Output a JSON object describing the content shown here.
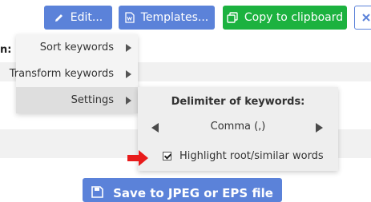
{
  "toolbar": {
    "edit_label": "Edit...",
    "templates_label": "Templates...",
    "copy_label": "Copy to clipboard",
    "cut_off_icon": "x-icon"
  },
  "form": {
    "label_fragment": "n:"
  },
  "menu": {
    "items": [
      {
        "label": "Sort keywords",
        "has_submenu": true
      },
      {
        "label": "Transform keywords",
        "has_submenu": true
      },
      {
        "label": "Settings",
        "has_submenu": true,
        "selected": true
      }
    ]
  },
  "settings_panel": {
    "title": "Delimiter of keywords:",
    "delimiter_value": "Comma (,)",
    "prev_icon": "chevron-left-icon",
    "next_icon": "chevron-right-icon",
    "highlight_label": "Highlight root/similar words",
    "highlight_checked": true
  },
  "annotation": {
    "arrow_icon": "red-arrow-icon",
    "color": "#e81b1b"
  },
  "save": {
    "label": "Save to JPEG or EPS file"
  },
  "colors": {
    "primary": "#5b82d9",
    "success": "#1cb23f",
    "menu_bg": "#f4f4f4",
    "menu_selected": "#dedede"
  }
}
